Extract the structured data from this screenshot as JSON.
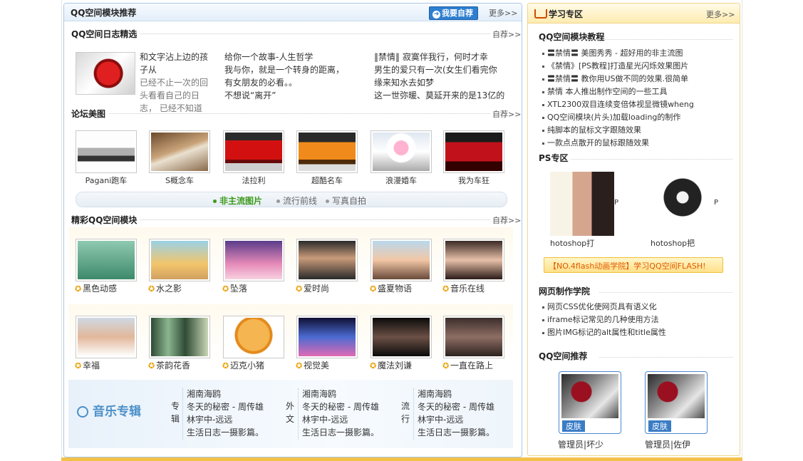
{
  "left": {
    "title": "QQ空间模块推荐",
    "self_button": "我要自荐",
    "more": "更多>>",
    "diary": {
      "title": "QQ空间日志精选",
      "more": "自荐>>",
      "col1": [
        "和文字沾上边的孩",
        "子从",
        "已经不止一次的回",
        "头看看自己的日",
        "志，  已经不知道"
      ],
      "col2": [
        "给你一个故事-人生哲学",
        "我与你，就是一个转身的距离，",
        "有女朋友的必看。。",
        "不想说“离开”"
      ],
      "col3": [
        "‖禁情‖  寂寞伴我行，何时才幸",
        "男生的爱只有一次(女生们看完你",
        "缘来知水去如梦",
        "这一世弥暖、莫延开来的是13亿的"
      ]
    },
    "forum": {
      "title": "论坛美图",
      "more": "自荐>>",
      "photos": [
        "Pagani跑车",
        "S概念车",
        "法拉利",
        "超酷名车",
        "浪漫婚车",
        "我为车狂"
      ],
      "tabs": [
        "非主流图片",
        "流行前线",
        "写真自拍"
      ]
    },
    "modules": {
      "title": "精彩QQ空间模块",
      "more": "自荐>>",
      "row1": [
        "黑色动感",
        "水之影",
        "坠落",
        "爱时尚",
        "盛夏物语",
        "音乐在线"
      ],
      "row2": [
        "幸福",
        "茶韵花香",
        "迈克小猪",
        "视觉美",
        "魔法刘谦",
        "一直在路上"
      ]
    },
    "music": {
      "title": "音乐专辑",
      "cat1": [
        "专",
        "辑"
      ],
      "cat2": [
        "外",
        "文"
      ],
      "cat3": [
        "流",
        "行"
      ],
      "col1": [
        "湘南海鸥",
        "冬天的秘密 - 周传雄",
        "林宇中-远远",
        "生活日志一摄影篇。"
      ],
      "col2": [
        "湘南海鸥",
        "冬天的秘密 - 周传雄",
        "林宇中-远远",
        "生活日志一摄影篇。"
      ],
      "col3": [
        "湘南海鸥",
        "冬天的秘密 - 周传雄",
        "林宇中-远远",
        "生活日志一摄影篇。"
      ]
    }
  },
  "right": {
    "title": "学习专区",
    "more": "更多>>",
    "tutorial_title": "QQ空间模块教程",
    "tutorials": [
      "〓禁情〓 美图秀秀 - 超好用的非主流图",
      "《禁情》[PS教程]打造星光闪烁效果图片",
      "〓禁情〓 教你用US做不同的效果.很简单",
      "禁情 本人推出制作空间的一些工具",
      "XTL2300双目连续变倍体视显微镜wheng",
      "QQ空间模块(片头)加载loading的制作",
      "纯脚本的鼠标文字跟随效果",
      "一款点点散开的鼠标跟随效果"
    ],
    "ps_title": "PS专区",
    "ps_items": [
      {
        "caption": "hotoshop打",
        "side": "P"
      },
      {
        "caption": "hotoshop把",
        "side": "P"
      }
    ],
    "flash": "【NO.4flash动画学院】学习QQ空间FLASH!",
    "web_title": "网页制作学院",
    "web_items": [
      "网页CSS优化使网页具有语义化",
      "iframe标记常见的几种使用方法",
      "图片IMG标记的alt属性和title属性"
    ],
    "recommend_title": "QQ空间推荐",
    "skins": [
      {
        "label": "皮肤",
        "caption": "管理员|坏少"
      },
      {
        "label": "皮肤",
        "caption": "管理员|佐伊"
      }
    ]
  }
}
